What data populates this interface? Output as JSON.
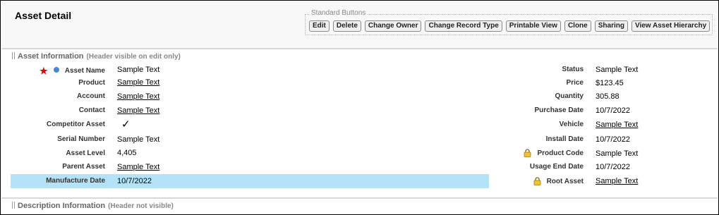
{
  "page": {
    "title": "Asset Detail"
  },
  "standard_buttons": {
    "legend": "Standard Buttons",
    "buttons": [
      "Edit",
      "Delete",
      "Change Owner",
      "Change Record Type",
      "Printable View",
      "Clone",
      "Sharing",
      "View Asset Hierarchy"
    ]
  },
  "asset_information": {
    "header": "Asset Information",
    "note": "(Header visible on edit only)",
    "left": [
      {
        "label": "Asset Name",
        "value": "Sample Text"
      },
      {
        "label": "Product",
        "value": "Sample Text"
      },
      {
        "label": "Account",
        "value": "Sample Text"
      },
      {
        "label": "Contact",
        "value": "Sample Text"
      },
      {
        "label": "Competitor Asset",
        "value": "✓"
      },
      {
        "label": "Serial Number",
        "value": "Sample Text"
      },
      {
        "label": "Asset Level",
        "value": "4,405"
      },
      {
        "label": "Parent Asset",
        "value": "Sample Text"
      },
      {
        "label": "Manufacture Date",
        "value": "10/7/2022"
      }
    ],
    "right": [
      {
        "label": "Status",
        "value": "Sample Text"
      },
      {
        "label": "Price",
        "value": "$123.45"
      },
      {
        "label": "Quantity",
        "value": "305.88"
      },
      {
        "label": "Purchase Date",
        "value": "10/7/2022"
      },
      {
        "label": "Vehicle",
        "value": "Sample Text"
      },
      {
        "label": "Install Date",
        "value": "10/7/2022"
      },
      {
        "label": "Product Code",
        "value": "Sample Text"
      },
      {
        "label": "Usage End Date",
        "value": "10/7/2022"
      },
      {
        "label": "Root Asset",
        "value": "Sample Text"
      }
    ]
  },
  "description_information": {
    "header": "Description Information",
    "note": "(Header not visible)"
  },
  "colors": {
    "highlight": "#b4e3f8",
    "required": "#dd0000",
    "indicator": "#4a84d4"
  }
}
